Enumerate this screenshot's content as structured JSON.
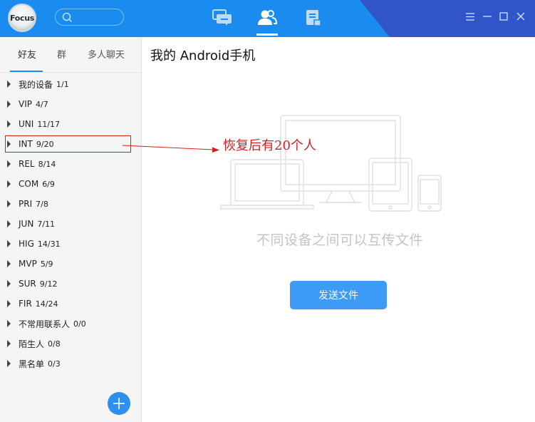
{
  "app": {
    "logo_text": "Focus"
  },
  "header": {
    "nav": [
      {
        "name": "messages",
        "icon": "chat-icon"
      },
      {
        "name": "contacts",
        "icon": "contacts-icon",
        "active": true
      },
      {
        "name": "files",
        "icon": "file-icon"
      }
    ],
    "window_controls": [
      "menu-icon",
      "minimize-icon",
      "maximize-icon",
      "close-icon"
    ],
    "colors": {
      "bar": "#1a8cf0",
      "accent": "#2f55c9"
    }
  },
  "sidebar": {
    "tabs": [
      "好友",
      "群",
      "多人聊天"
    ],
    "active_tab": "好友",
    "groups": [
      {
        "name": "我的设备",
        "count": "1/1"
      },
      {
        "name": "VIP",
        "count": "4/7"
      },
      {
        "name": "UNI",
        "count": "11/17"
      },
      {
        "name": "INT",
        "count": "9/20"
      },
      {
        "name": "REL",
        "count": "8/14"
      },
      {
        "name": "COM",
        "count": "6/9"
      },
      {
        "name": "PRI",
        "count": "7/8"
      },
      {
        "name": "JUN",
        "count": "7/11"
      },
      {
        "name": "HIG",
        "count": "14/31"
      },
      {
        "name": "MVP",
        "count": "5/9"
      },
      {
        "name": "SUR",
        "count": "9/12"
      },
      {
        "name": "FIR",
        "count": "14/24"
      },
      {
        "name": "不常用联系人",
        "count": "0/0"
      },
      {
        "name": "陌生人",
        "count": "0/8"
      },
      {
        "name": "黑名单",
        "count": "0/3"
      }
    ]
  },
  "main": {
    "title": "我的 Android手机",
    "caption": "不同设备之间可以互传文件",
    "send_button": "发送文件"
  },
  "annotation": {
    "text": "恢复后有20个人",
    "color": "#d11f1f"
  }
}
